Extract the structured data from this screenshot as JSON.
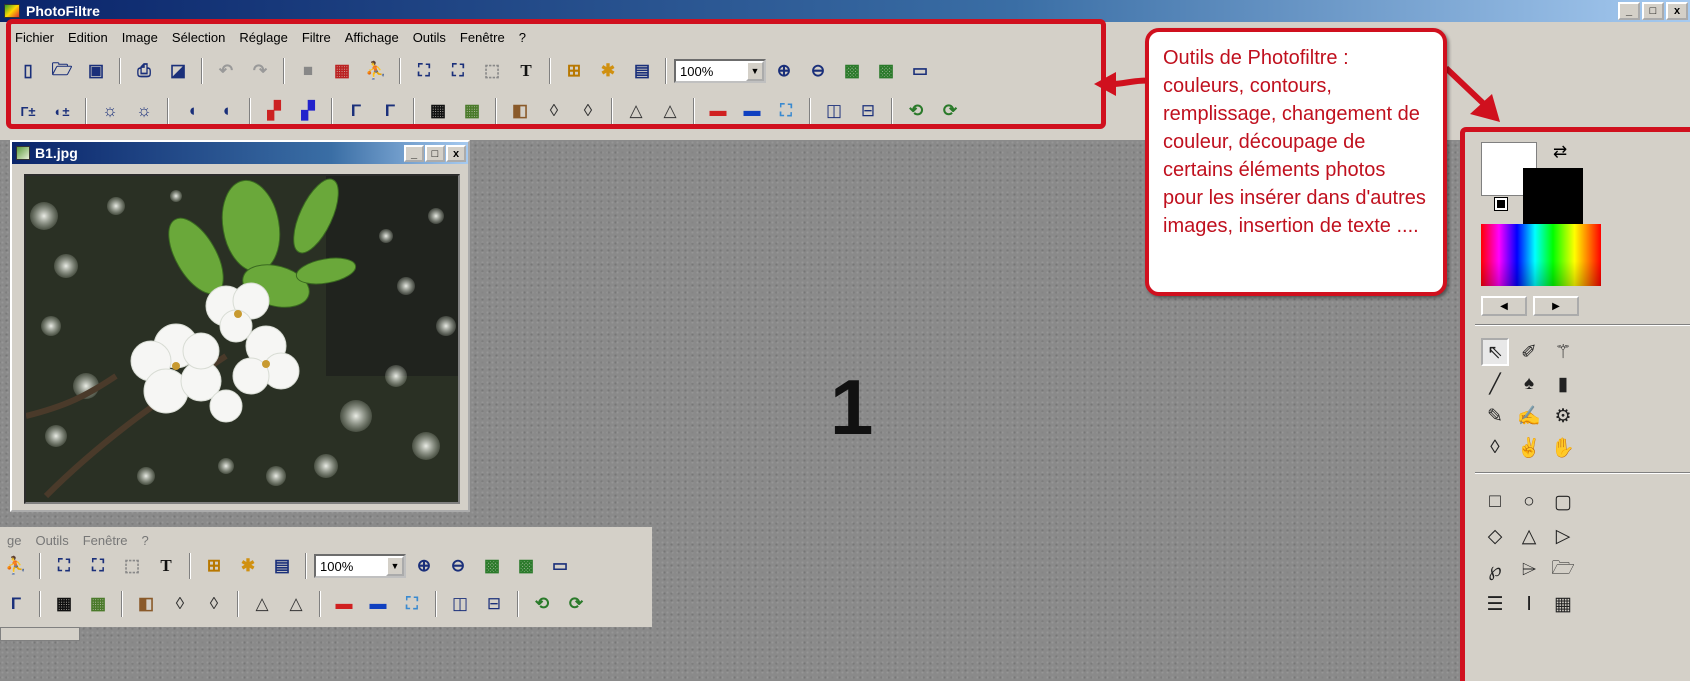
{
  "app": {
    "title": "PhotoFiltre"
  },
  "window_controls": [
    "_",
    "□",
    "x"
  ],
  "menu": [
    "Fichier",
    "Edition",
    "Image",
    "Sélection",
    "Réglage",
    "Filtre",
    "Affichage",
    "Outils",
    "Fenêtre",
    "?"
  ],
  "toolbar": {
    "zoom_value": "100%"
  },
  "callout": {
    "text": "Outils de Photofiltre : couleurs, contours, remplissage, changement de couleur, découpage de certains éléments photos pour les insérer dans d'autres images, insertion de texte ...."
  },
  "document": {
    "title": "B1.jpg"
  },
  "label_number": "1",
  "ghost": {
    "menu": [
      "ge",
      "Outils",
      "Fenêtre",
      "?"
    ],
    "zoom_value": "100%"
  },
  "colors": {
    "accent_red": "#d0101e",
    "title_blue": "#0a246a",
    "callout_text": "#c0101e"
  },
  "icons": {
    "toolbar1": [
      "new-file-icon",
      "open-folder-icon",
      "save-icon",
      "print-icon",
      "scan-icon",
      "undo-icon",
      "redo-icon",
      "gray-square-icon",
      "color-grid-icon",
      "run-man-icon",
      "filter-a-icon",
      "filter-b-icon",
      "selection-icon",
      "text-icon",
      "tree-icon",
      "star-icon",
      "window-icon",
      "zoom-in-icon",
      "zoom-out-icon",
      "fit-image-icon",
      "actual-size-icon",
      "fullscreen-icon"
    ],
    "toolbar2": [
      "auto-levels-icon",
      "auto-contrast-icon",
      "brightness-minus-icon",
      "brightness-plus-icon",
      "contrast-minus-icon",
      "contrast-plus-icon",
      "saturation-minus-icon",
      "saturation-plus-icon",
      "gamma-minus-icon",
      "gamma-plus-icon",
      "grid-icon",
      "grid-green-icon",
      "layer-icon",
      "blur-icon",
      "blur-more-icon",
      "sharpen-icon",
      "sharpen-more-icon",
      "gradient-h-icon",
      "gradient-v-icon",
      "effect-icon",
      "flip-h-icon",
      "flip-v-icon",
      "rotate-icon",
      "rotate-alt-icon"
    ],
    "palette": [
      "pointer-icon",
      "eyedropper-icon",
      "magic-wand-icon",
      "line-icon",
      "fill-bucket-icon",
      "spray-icon",
      "brush-icon",
      "brush-plus-icon",
      "stamp-icon",
      "drop-icon",
      "smudge-icon",
      "hand-icon",
      "rectangle-icon",
      "ellipse-icon",
      "rounded-rect-icon",
      "diamond-icon",
      "triangle-icon",
      "play-shape-icon",
      "lasso-icon",
      "polygon-icon",
      "folder-shape-icon",
      "equal-icon",
      "text-field-icon",
      "number-icon"
    ]
  }
}
